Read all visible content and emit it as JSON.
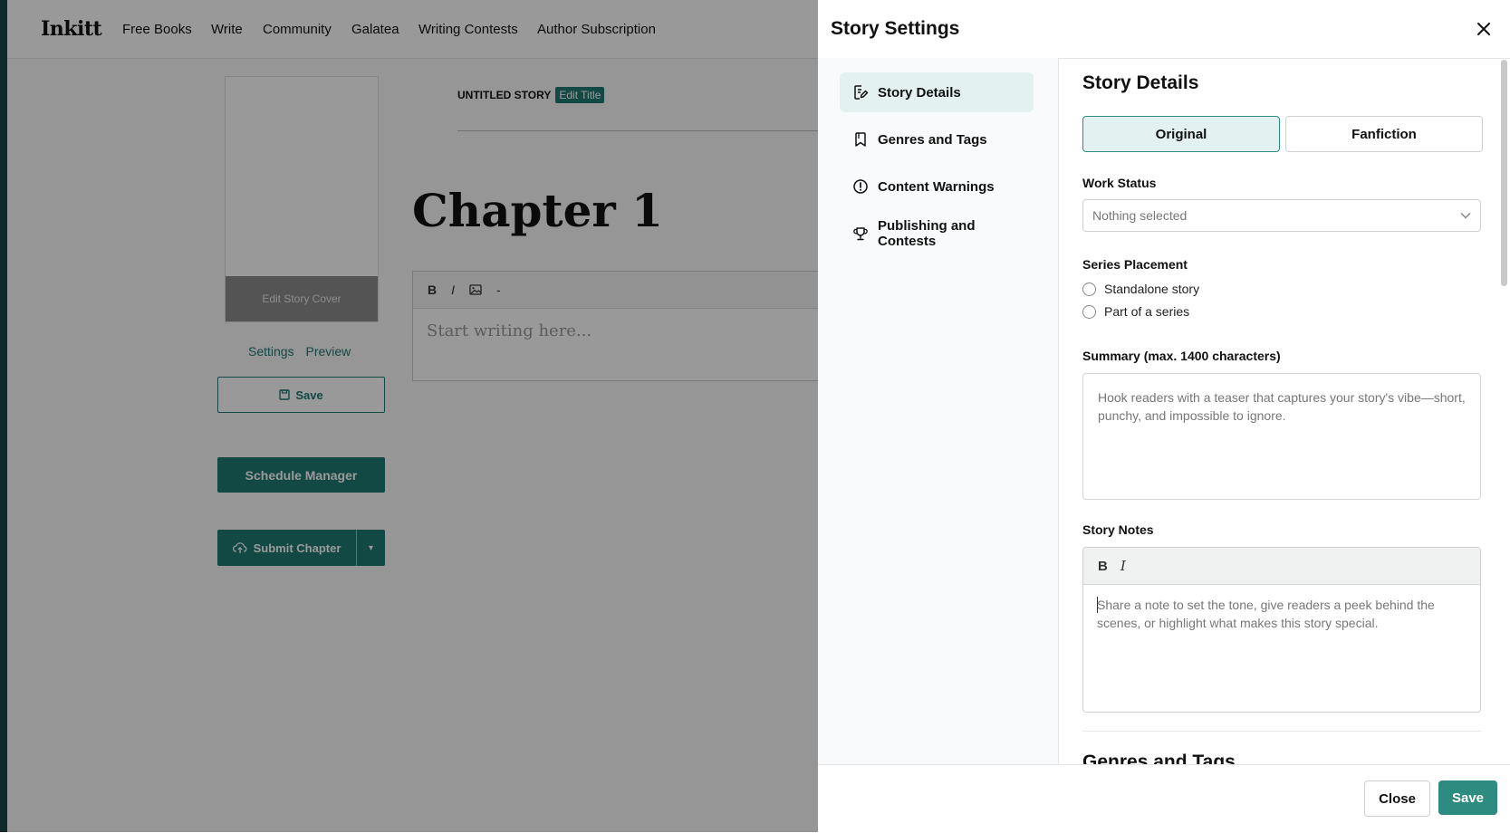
{
  "colors": {
    "accent": "#2d8b80",
    "accent_dark": "#1f7a72",
    "active_bg": "#e3f2f0"
  },
  "nav": {
    "logo": "Inkitt",
    "links": [
      "Free Books",
      "Write",
      "Community",
      "Galatea",
      "Writing Contests",
      "Author Subscription"
    ]
  },
  "editor_page": {
    "cover_button": "Edit Story Cover",
    "settings_link": "Settings",
    "preview_link": "Preview",
    "save_label": "Save",
    "schedule_label": "Schedule Manager",
    "submit_label": "Submit Chapter",
    "story_title": "UNTITLED STORY",
    "edit_title": "Edit Title",
    "chapter_heading": "Chapter 1",
    "toolbar": [
      "B",
      "I",
      "image-icon",
      "-"
    ],
    "editor_placeholder": "Start writing here..."
  },
  "drawer": {
    "title": "Story Settings",
    "sidebar": [
      {
        "label": "Story Details",
        "icon": "edit-doc-icon",
        "active": true
      },
      {
        "label": "Genres and Tags",
        "icon": "bookmark-icon",
        "active": false
      },
      {
        "label": "Content Warnings",
        "icon": "alert-circle-icon",
        "active": false
      },
      {
        "label": "Publishing and Contests",
        "icon": "trophy-icon",
        "active": false
      }
    ],
    "details": {
      "heading": "Story Details",
      "type_original": "Original",
      "type_fanfiction": "Fanfiction",
      "work_status_label": "Work Status",
      "work_status_value": "Nothing selected",
      "series_label": "Series Placement",
      "series_options": [
        "Standalone story",
        "Part of a series"
      ],
      "summary_label": "Summary (max. 1400 characters)",
      "summary_placeholder": "Hook readers with a teaser that captures your story's vibe—short, punchy, and impossible to ignore.",
      "notes_label": "Story Notes",
      "notes_bold": "B",
      "notes_italic": "I",
      "notes_placeholder": "Share a note to set the tone, give readers a peek behind the scenes, or highlight what makes this story special."
    },
    "next_section": "Genres and Tags",
    "footer": {
      "close": "Close",
      "save": "Save"
    }
  }
}
